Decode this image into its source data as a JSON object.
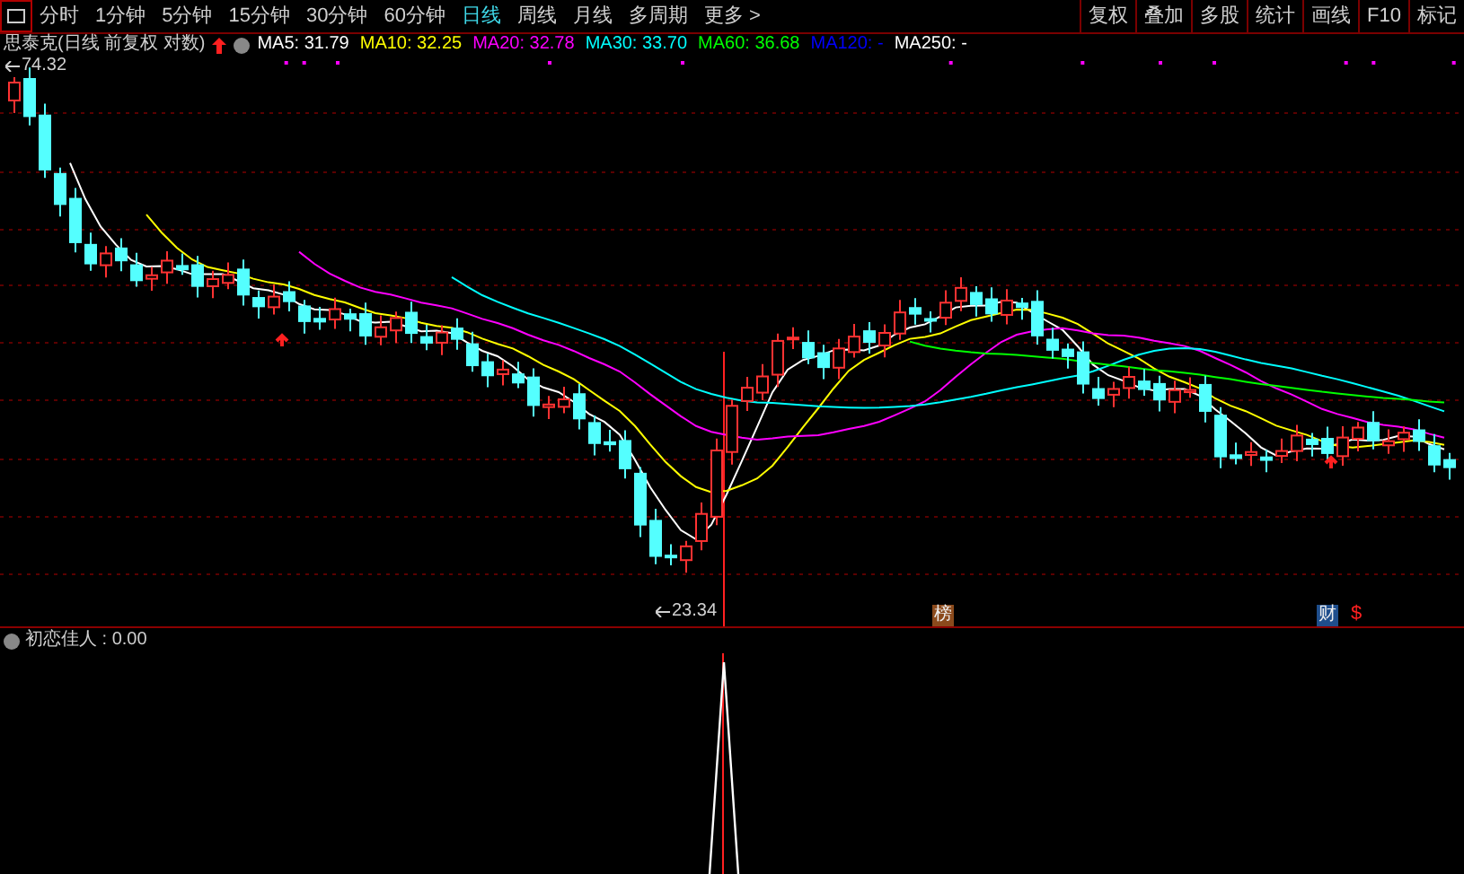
{
  "toolbar": {
    "tabs": [
      {
        "label": "分时",
        "selected": false
      },
      {
        "label": "1分钟",
        "selected": false
      },
      {
        "label": "5分钟",
        "selected": false
      },
      {
        "label": "15分钟",
        "selected": false
      },
      {
        "label": "30分钟",
        "selected": false
      },
      {
        "label": "60分钟",
        "selected": false
      },
      {
        "label": "日线",
        "selected": true
      },
      {
        "label": "周线",
        "selected": false
      },
      {
        "label": "月线",
        "selected": false
      },
      {
        "label": "多周期",
        "selected": false
      },
      {
        "label": "更多 >",
        "selected": false
      }
    ],
    "buttons": [
      "复权",
      "叠加",
      "多股",
      "统计",
      "画线",
      "F10",
      "标记"
    ]
  },
  "legend": {
    "title": "思泰克(日线 前复权 对数)",
    "indicators": [
      {
        "label": "MA5: 31.79",
        "color": "#ffffff"
      },
      {
        "label": "MA10: 32.25",
        "color": "#ffff00"
      },
      {
        "label": "MA20: 32.78",
        "color": "#ff00ff"
      },
      {
        "label": "MA30: 33.70",
        "color": "#00ffff"
      },
      {
        "label": "MA60: 36.68",
        "color": "#00ff00"
      },
      {
        "label": "MA120: -",
        "color": "#0000ff"
      },
      {
        "label": "MA250: -",
        "color": "#ffffff"
      }
    ]
  },
  "chart": {
    "high_label": "74.32",
    "low_label": "23.34",
    "markers": [
      {
        "label": "榜",
        "kind": "badge",
        "color": "#8b4a1c"
      },
      {
        "label": "财",
        "kind": "badge",
        "color": "#1f4e8c"
      },
      {
        "label": "$",
        "kind": "glyph",
        "color": "#ff2020"
      }
    ]
  },
  "sub_panel": {
    "label": "初恋佳人 : 0.00"
  }
}
